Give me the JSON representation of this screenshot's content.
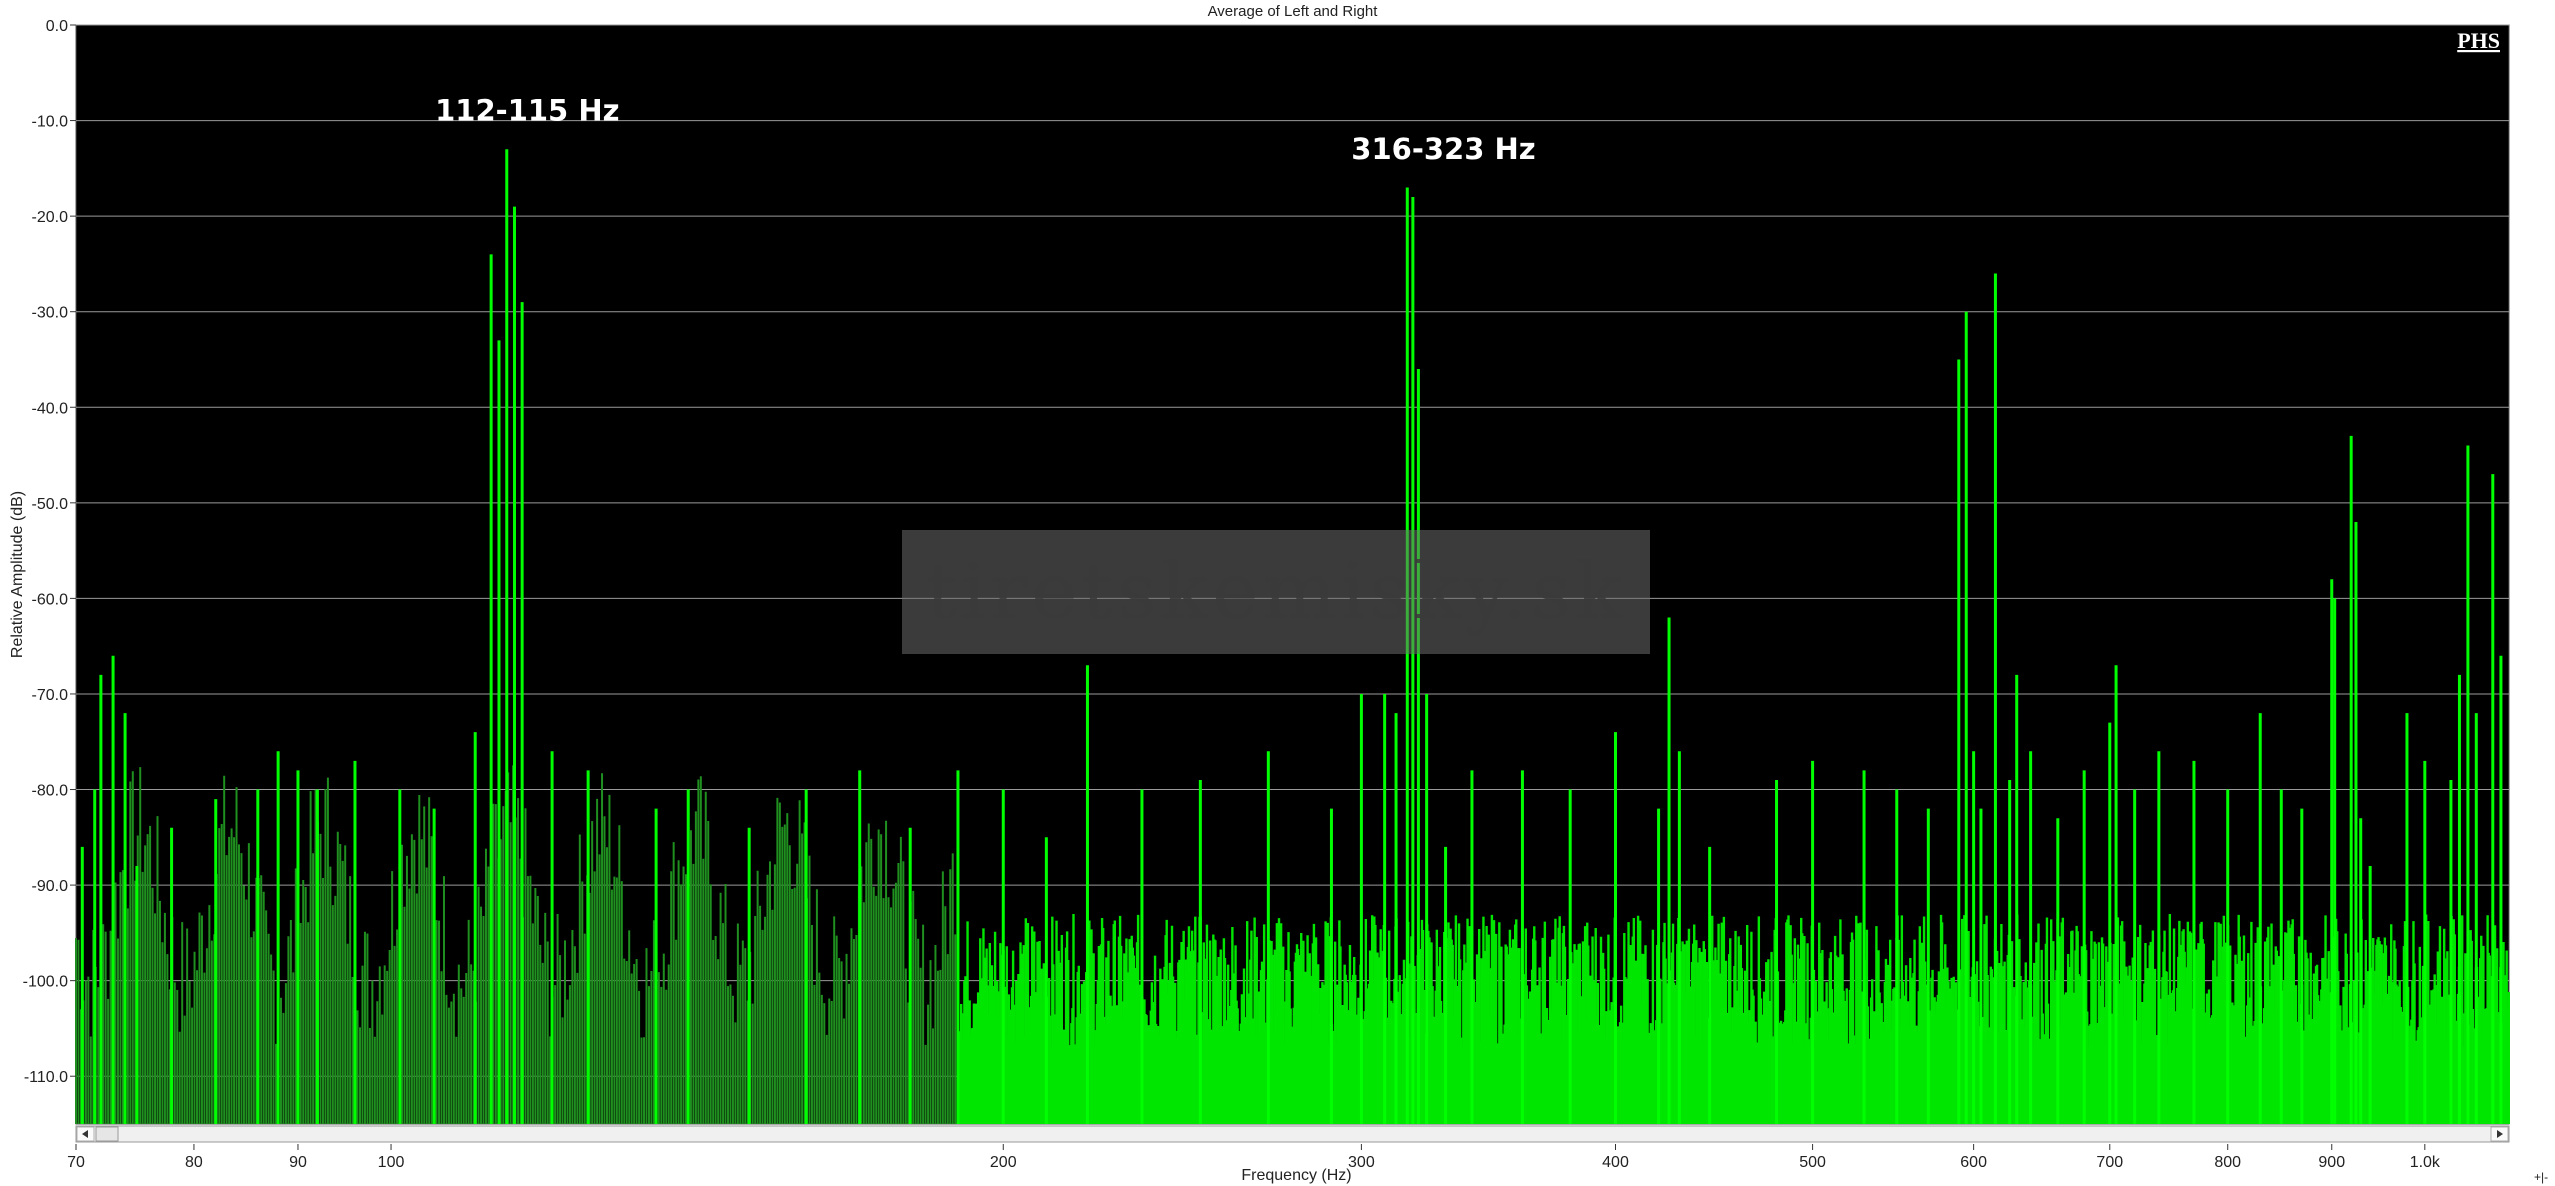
{
  "chart_data": {
    "type": "bar",
    "title": "Average of Left and Right",
    "xlabel": "Frequency (Hz)",
    "ylabel": "Relative Amplitude (dB)",
    "x_scale": "log",
    "xlim": [
      70,
      1100
    ],
    "ylim": [
      -115,
      0
    ],
    "grid": true,
    "x_ticks": [
      {
        "value": 70,
        "label": "70"
      },
      {
        "value": 80,
        "label": "80"
      },
      {
        "value": 90,
        "label": "90"
      },
      {
        "value": 100,
        "label": "100"
      },
      {
        "value": 200,
        "label": "200"
      },
      {
        "value": 300,
        "label": "300"
      },
      {
        "value": 400,
        "label": "400"
      },
      {
        "value": 500,
        "label": "500"
      },
      {
        "value": 600,
        "label": "600"
      },
      {
        "value": 700,
        "label": "700"
      },
      {
        "value": 800,
        "label": "800"
      },
      {
        "value": 900,
        "label": "900"
      },
      {
        "value": 1000,
        "label": "1.0k"
      }
    ],
    "y_ticks": [
      {
        "value": 0,
        "label": "0.0"
      },
      {
        "value": -10,
        "label": "-10.0"
      },
      {
        "value": -20,
        "label": "-20.0"
      },
      {
        "value": -30,
        "label": "-30.0"
      },
      {
        "value": -40,
        "label": "-40.0"
      },
      {
        "value": -50,
        "label": "-50.0"
      },
      {
        "value": -60,
        "label": "-60.0"
      },
      {
        "value": -70,
        "label": "-70.0"
      },
      {
        "value": -80,
        "label": "-80.0"
      },
      {
        "value": -90,
        "label": "-90.0"
      },
      {
        "value": -100,
        "label": "-100.0"
      },
      {
        "value": -110,
        "label": "-110.0"
      }
    ],
    "series": [
      {
        "x": [
          70.5,
          71.5,
          72,
          73,
          74,
          75,
          78,
          82,
          86,
          88,
          90,
          92,
          96,
          101,
          105,
          110,
          112,
          113,
          114,
          115,
          116,
          120,
          125,
          135,
          140,
          150,
          160,
          170,
          180,
          190,
          200,
          210,
          220,
          234,
          250,
          270,
          290,
          300,
          308,
          312,
          316,
          318,
          320,
          323,
          330,
          340,
          360,
          380,
          400,
          420,
          425,
          430,
          445,
          480,
          500,
          530,
          550,
          570,
          590,
          595,
          600,
          605,
          615,
          625,
          630,
          640,
          660,
          680,
          700,
          705,
          720,
          740,
          770,
          800,
          830,
          850,
          870,
          900,
          903,
          920,
          925,
          930,
          940,
          980,
          1000,
          1030,
          1040,
          1050,
          1060,
          1080,
          1090
        ],
        "y": [
          -86,
          -80,
          -68,
          -66,
          -72,
          -88,
          -84,
          -81,
          -80,
          -76,
          -78,
          -80,
          -77,
          -80,
          -82,
          -74,
          -24,
          -33,
          -13,
          -19,
          -29,
          -76,
          -78,
          -82,
          -80,
          -84,
          -80,
          -78,
          -84,
          -78,
          -80,
          -85,
          -67,
          -80,
          -79,
          -76,
          -82,
          -70,
          -70,
          -72,
          -17,
          -18,
          -36,
          -70,
          -86,
          -78,
          -78,
          -80,
          -74,
          -82,
          -62,
          -76,
          -86,
          -79,
          -77,
          -78,
          -80,
          -82,
          -35,
          -30,
          -76,
          -82,
          -26,
          -79,
          -68,
          -76,
          -83,
          -78,
          -73,
          -67,
          -80,
          -76,
          -77,
          -80,
          -72,
          -80,
          -82,
          -58,
          -60,
          -43,
          -52,
          -83,
          -88,
          -72,
          -77,
          -79,
          -68,
          -44,
          -72,
          -47,
          -66
        ],
        "color": "#00ff00"
      }
    ],
    "annotations": [
      {
        "text": "112-115 Hz",
        "x": 112,
        "y": -10
      },
      {
        "text": "316-323 Hz",
        "x": 316,
        "y": -14
      }
    ],
    "watermark": "tiretskemisky.sk",
    "logo": "PHS"
  }
}
